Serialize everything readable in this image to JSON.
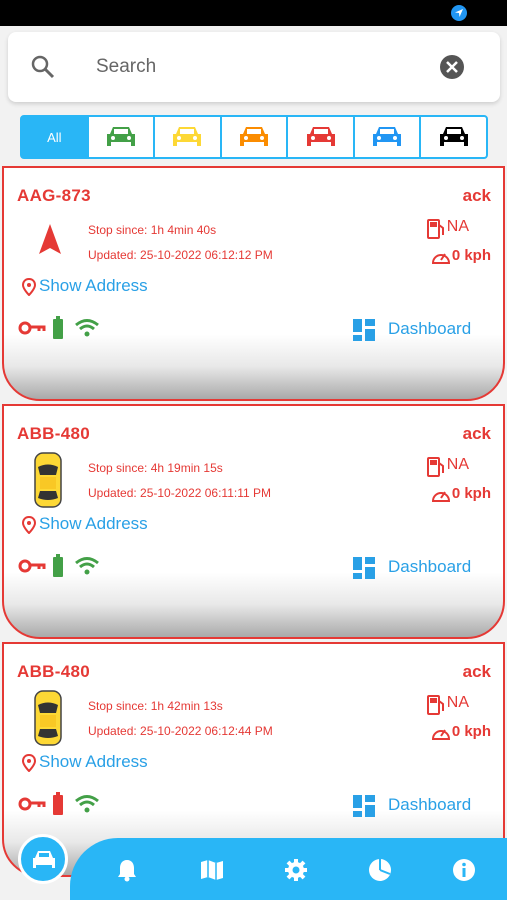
{
  "search": {
    "placeholder": "Search"
  },
  "filters": [
    {
      "label": "All",
      "color": "#ffffff"
    },
    {
      "label": "",
      "color": "#43a047"
    },
    {
      "label": "",
      "color": "#fdd835"
    },
    {
      "label": "",
      "color": "#fb8c00"
    },
    {
      "label": "",
      "color": "#e53935"
    },
    {
      "label": "",
      "color": "#2196f3"
    },
    {
      "label": "",
      "color": "#000000"
    }
  ],
  "vehicles": [
    {
      "plate": "AAG-873",
      "status": "ack",
      "stop": "Stop since: 1h 4min 40s",
      "updated": "Updated: 25-10-2022 06:12:12 PM",
      "fuel": "NA",
      "speed": "0 kph",
      "address": "Show Address",
      "dashboard": "Dashboard",
      "icon": "red-arrow"
    },
    {
      "plate": "ABB-480",
      "status": "ack",
      "stop": "Stop since: 4h 19min 15s",
      "updated": "Updated: 25-10-2022 06:11:11 PM",
      "fuel": "NA",
      "speed": "0 kph",
      "address": "Show Address",
      "dashboard": "Dashboard",
      "icon": "yellow-car"
    },
    {
      "plate": "ABB-480",
      "status": "ack",
      "stop": "Stop since: 1h 42min 13s",
      "updated": "Updated: 25-10-2022 06:12:44 PM",
      "fuel": "NA",
      "speed": "0 kph",
      "address": "Show Address",
      "dashboard": "Dashboard",
      "icon": "yellow-car"
    }
  ],
  "colors": {
    "accent": "#29b6f6",
    "alert": "#e53935",
    "link": "#29a0e6",
    "ok": "#43a047"
  }
}
